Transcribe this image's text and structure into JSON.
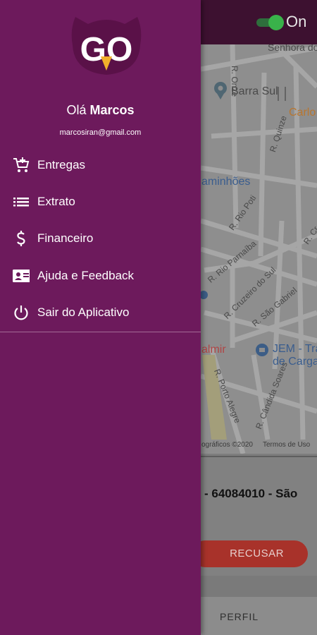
{
  "topbar": {
    "toggle_label": "On"
  },
  "map": {
    "labels": {
      "senhora": "Senhora do",
      "r_onze": "R. Onze",
      "barra_sul": "Barra Sul",
      "carlo": "Carlo",
      "r_quinze": "R. Quinze",
      "caminhoes": "aminhões",
      "r_rio_poti": "R. Rio Poti",
      "r_cr": "R. Cr",
      "r_rio_parnaiba": "R. Rio Parnaíba",
      "r_cruzeiro": "R. Cruzeiro do Sul",
      "r_sao_gabriel": "R. São Gabriel",
      "almir": "almir",
      "jem_line1": "JEM - Tra",
      "jem_line2": "de Carga",
      "r_porto_alegre": "R. Porto Alegre",
      "r_candida": "R. Cândida Soares"
    },
    "footer_data": "ográficos ©2020",
    "footer_terms": "Termos de Uso"
  },
  "card": {
    "address": "- 64084010 - São",
    "reject_label": "RECUSAR"
  },
  "bottom_nav": {
    "profile_label": "PERFIL"
  },
  "drawer": {
    "logo_text": "GO",
    "greeting_prefix": "Olá",
    "user_name": "Marcos",
    "email": "marcosiran@gmail.com",
    "menu": [
      {
        "label": "Entregas",
        "icon": "cart-plus-icon"
      },
      {
        "label": "Extrato",
        "icon": "list-icon"
      },
      {
        "label": "Financeiro",
        "icon": "dollar-icon"
      },
      {
        "label": "Ajuda e Feedback",
        "icon": "contact-card-icon"
      },
      {
        "label": "Sair do Aplicativo",
        "icon": "power-icon"
      }
    ]
  },
  "colors": {
    "drawer_bg": "#6d1a5c",
    "topbar_bg": "#3d1130",
    "toggle_on": "#39b24a",
    "reject_button": "#a8322a",
    "logo_beak": "#f2b02b"
  }
}
